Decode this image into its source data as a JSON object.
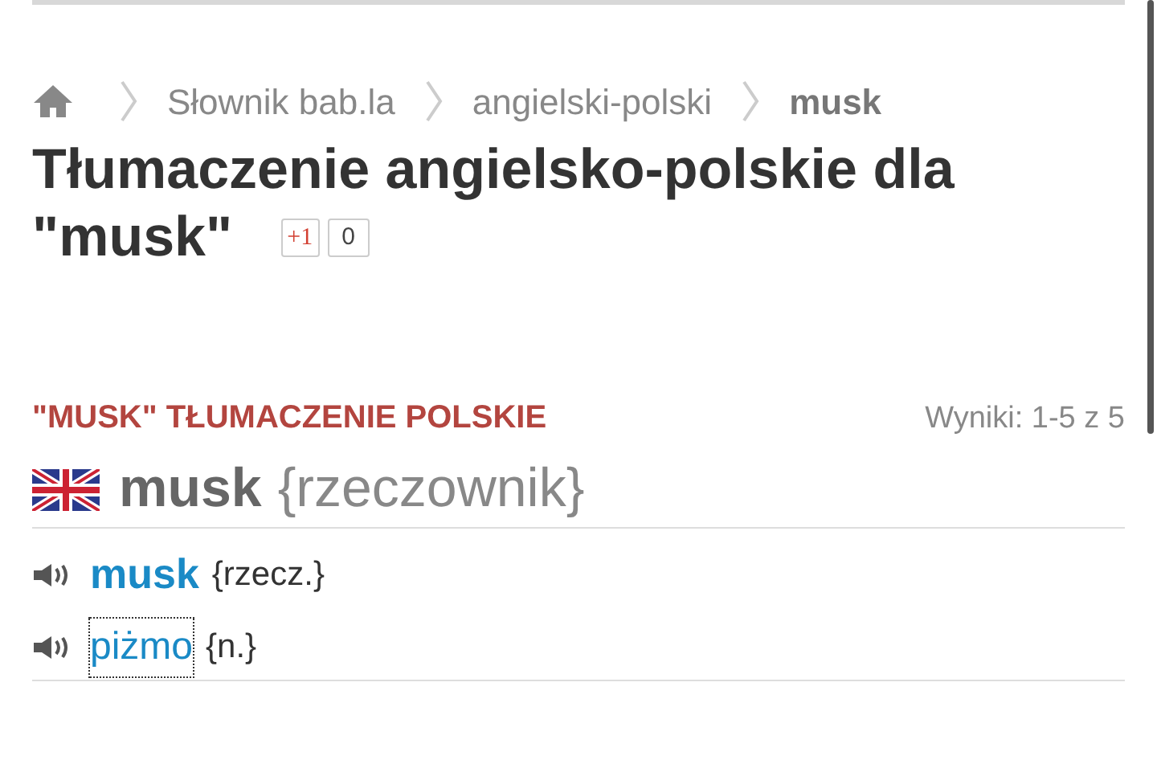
{
  "breadcrumb": [
    {
      "label": "Słownik bab.la",
      "current": false
    },
    {
      "label": "angielski-polski",
      "current": false
    },
    {
      "label": "musk",
      "current": true
    }
  ],
  "heading_lines": [
    "Tłumaczenie angielsko-polskie dla",
    "\"musk\""
  ],
  "plus_one": {
    "label": "+1",
    "count": "0"
  },
  "section": {
    "title": "\"MUSK\" TŁUMACZENIE POLSKIE",
    "results": "Wyniki: 1-5 z 5"
  },
  "headword": {
    "word": "musk",
    "pos": "{rzeczownik}"
  },
  "translations": [
    {
      "word": "musk",
      "pos": "{rzecz.}",
      "bold": true,
      "focused": false
    },
    {
      "word": "piżmo",
      "pos": "{n.}",
      "bold": false,
      "focused": true
    }
  ]
}
